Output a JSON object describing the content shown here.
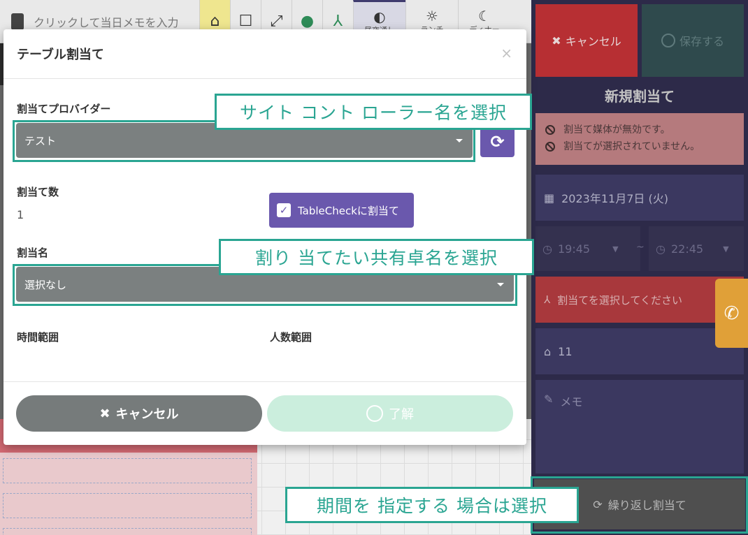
{
  "topbar": {
    "memo_placeholder": "クリックして当日メモを入力",
    "meal_tabs": [
      {
        "label": "昼夜通し",
        "icon": "half-circle-icon"
      },
      {
        "label": "ランチ",
        "icon": "sun-icon"
      },
      {
        "label": "ディナー",
        "icon": "moon-icon"
      }
    ]
  },
  "right_panel": {
    "cancel_label": "キャンセル",
    "save_label": "保存する",
    "title": "新規割当て",
    "errors": [
      "割当て媒体が無効です。",
      "割当てが選択されていません。"
    ],
    "date": "2023年11月7日 (火)",
    "time_start": "19:45",
    "time_sep": "~",
    "time_end": "22:45",
    "assign_placeholder": "割当てを選択してください",
    "table_value": "11",
    "memo_placeholder": "メモ",
    "repeat_label": "繰り返し割当て"
  },
  "modal": {
    "title": "テーブル割当て",
    "close": "×",
    "provider_label": "割当てプロバイダー",
    "provider_value": "テスト",
    "count_label": "割当て数",
    "count_value": "1",
    "tablecheck_label": "TableCheckに割当て",
    "name_label": "割当名",
    "name_value": "選択なし",
    "time_range_label": "時間範囲",
    "people_range_label": "人数範囲",
    "cancel_label": "キャンセル",
    "ok_label": "了解"
  },
  "callouts": {
    "provider": "サイト コント ローラー名を選択",
    "table": "割り 当てたい共有卓名を選択",
    "repeat": "期間を 指定する 場合は選択"
  },
  "colors": {
    "accent_teal": "#2aa592",
    "purple": "#6a58ad",
    "panel_bg": "#2d2a49",
    "danger": "#b72f33"
  }
}
